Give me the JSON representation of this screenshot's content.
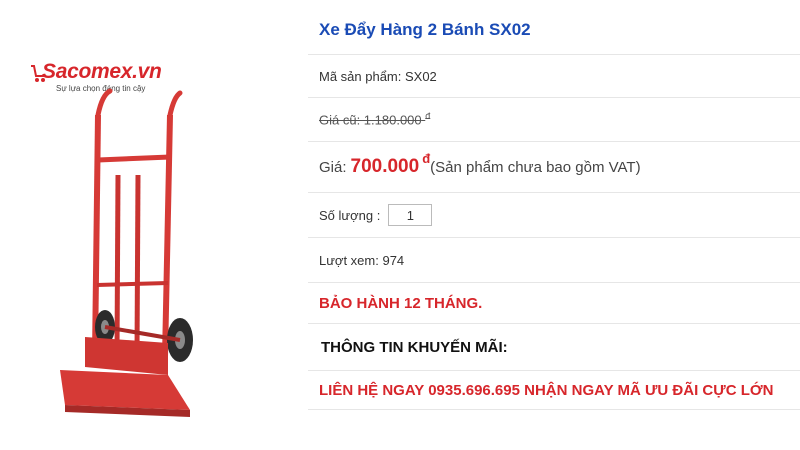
{
  "logo": {
    "brand": "acomex.vn",
    "brand_initial": "S",
    "tagline": "Sự lựa chọn đáng tin cậy"
  },
  "product": {
    "title": "Xe Đẩy Hàng 2 Bánh SX02",
    "sku_label": "Mã sản phẩm: SX02",
    "old_price": "Giá cũ: 1.180.000",
    "old_price_currency": "đ",
    "price_label": "Giá:",
    "price_value": "700.000",
    "price_currency": "đ",
    "price_note": "(Sản phẩm chưa bao gồm VAT)",
    "quantity_label": "Số lượng :",
    "quantity_value": "1",
    "views": "Lượt xem: 974",
    "warranty": "BẢO HÀNH 12 THÁNG.",
    "promo_title": "THÔNG TIN KHUYẾN MÃI:",
    "promo_text": "LIÊN HỆ NGAY 0935.696.695 NHẬN NGAY MÃ ƯU ĐÃI CỰC LỚN"
  },
  "colors": {
    "title_blue": "#1a4bb5",
    "accent_red": "#d7262b",
    "trolley_red": "#d63a36"
  },
  "icons": {
    "logo_cart": "shopping-cart-icon"
  }
}
